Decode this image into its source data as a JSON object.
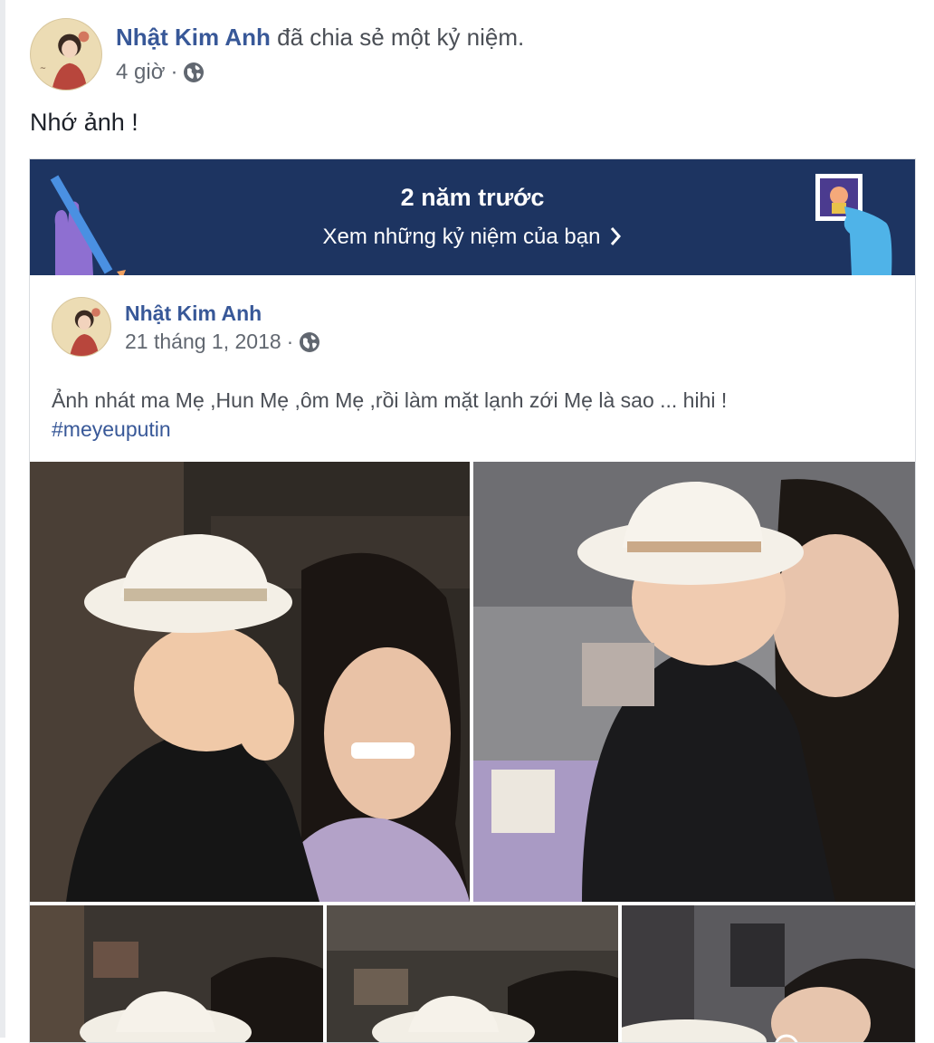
{
  "post": {
    "author": "Nhật Kim Anh",
    "action": " đã chia sẻ một kỷ niệm.",
    "time": "4 giờ",
    "separator": "·",
    "text": "Nhớ ảnh !",
    "icons": {
      "privacy": "globe-icon"
    }
  },
  "memory": {
    "title": "2 năm trước",
    "link_label": "Xem những kỷ niệm của bạn",
    "icons": {
      "link": "chevron-right-icon",
      "left_decoration": "hand-pencil-illustration",
      "right_decoration": "hand-photo-illustration"
    },
    "colors": {
      "banner": "#1d3461"
    }
  },
  "original_post": {
    "author": "Nhật Kim Anh",
    "date": "21 tháng 1, 2018",
    "separator": "·",
    "text": "Ảnh nhát ma Mẹ ,Hun Mẹ ,ôm Mẹ ,rồi làm mặt lạnh zới Mẹ là sao ... hihi !",
    "hashtag": "#meyeuputin",
    "photos": [
      "photo-1",
      "photo-2",
      "photo-3",
      "photo-4",
      "photo-5"
    ]
  },
  "colors": {
    "link": "#385898",
    "text": "#1d2129",
    "meta": "#616770"
  }
}
